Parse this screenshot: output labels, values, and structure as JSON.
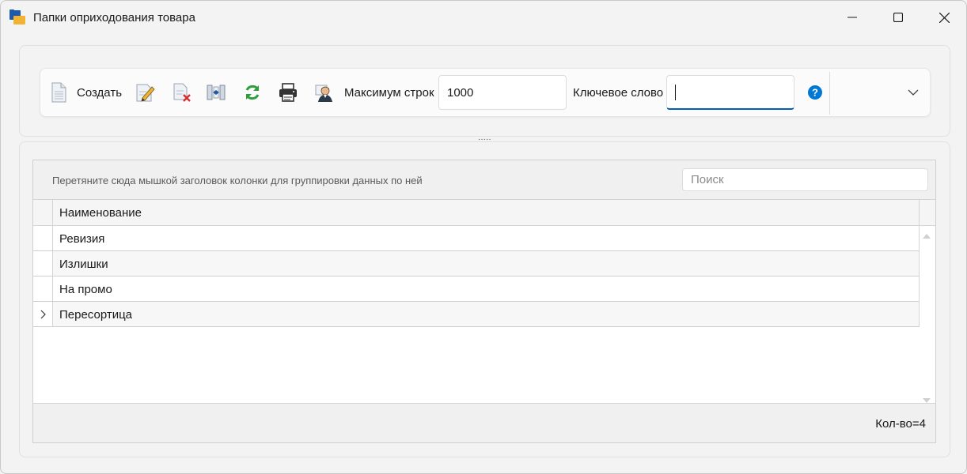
{
  "window": {
    "title": "Папки оприходования товара"
  },
  "toolbar": {
    "create_label": "Создать",
    "max_rows_label": "Максимум строк",
    "max_rows_value": "1000",
    "keyword_label": "Ключевое слово",
    "keyword_value": ""
  },
  "grid": {
    "group_hint": "Перетяните сюда мышкой заголовок колонки для группировки данных по ней",
    "search_placeholder": "Поиск",
    "columns": [
      "Наименование"
    ],
    "rows": [
      {
        "name": "Ревизия"
      },
      {
        "name": "Излишки"
      },
      {
        "name": "На промо"
      },
      {
        "name": "Пересортица"
      }
    ],
    "count_text": "Кол-во=4"
  },
  "colors": {
    "accent": "#005fb8",
    "help": "#0078d4",
    "refresh": "#2e9e3a",
    "delete": "#d32f2f",
    "folder_blue": "#1e5aa8",
    "folder_yellow": "#f2b233"
  }
}
